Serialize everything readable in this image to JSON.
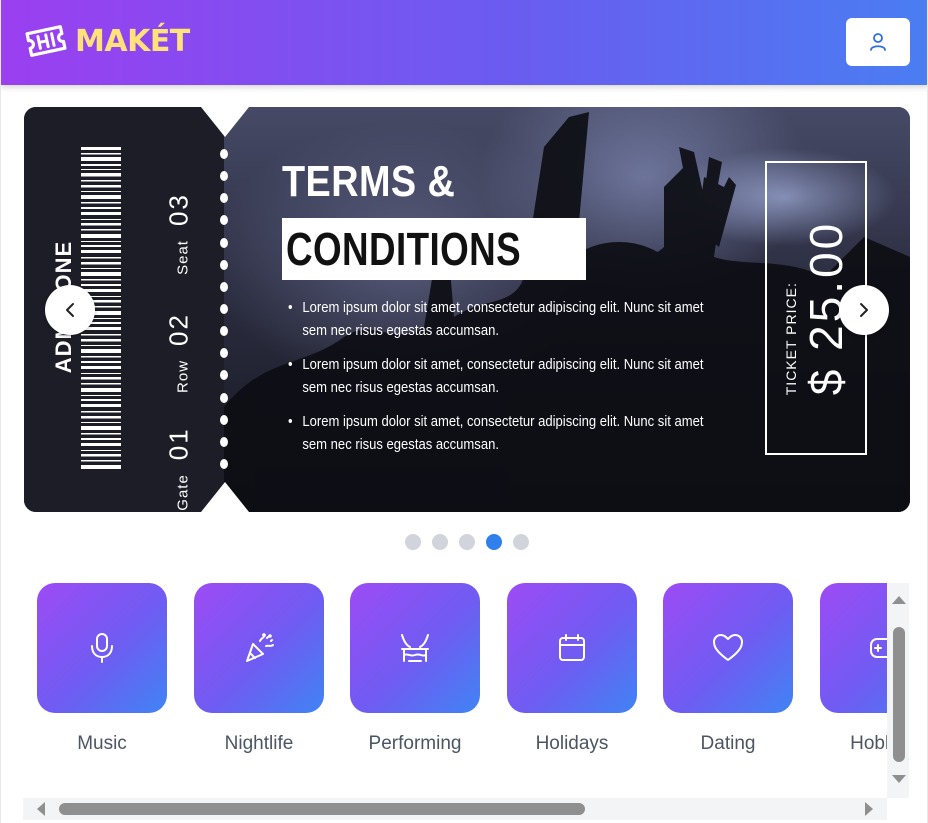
{
  "header": {
    "logo_text": "MAKÉT",
    "logo_icon": "ticket-logo-icon",
    "user_icon": "user-icon",
    "gradient_colors": [
      "#9b3ff0",
      "#4a7df2"
    ],
    "logo_text_color": "#ffe27a"
  },
  "banner": {
    "admit": "ADMIT ONE",
    "gate_label": "Gate",
    "gate_value": "01",
    "row_label": "Row",
    "row_value": "02",
    "seat_label": "Seat",
    "seat_value": "03",
    "title_line1": "TERMS &",
    "title_line2": "CONDITIONS",
    "bullets": [
      "Lorem ipsum dolor sit amet, consectetur adipiscing elit. Nunc sit amet sem nec risus egestas accumsan.",
      "Lorem ipsum dolor sit amet, consectetur adipiscing elit. Nunc sit amet sem nec risus egestas accumsan.",
      "Lorem ipsum dolor sit amet, consectetur adipiscing elit. Nunc sit amet sem nec risus egestas accumsan."
    ],
    "price_label": "TICKET PRICE:",
    "price_value": "$ 25.00",
    "prev_icon": "chevron-left-icon",
    "next_icon": "chevron-right-icon"
  },
  "carousel": {
    "slide_count": 5,
    "active_index": 3,
    "active_color": "#2f80ed"
  },
  "categories": [
    {
      "label": "Music",
      "icon": "microphone-icon"
    },
    {
      "label": "Nightlife",
      "icon": "party-popper-icon"
    },
    {
      "label": "Performing",
      "icon": "theater-stage-icon"
    },
    {
      "label": "Holidays",
      "icon": "calendar-icon"
    },
    {
      "label": "Dating",
      "icon": "heart-icon"
    },
    {
      "label": "Hobbies",
      "icon": "gamepad-icon"
    }
  ]
}
